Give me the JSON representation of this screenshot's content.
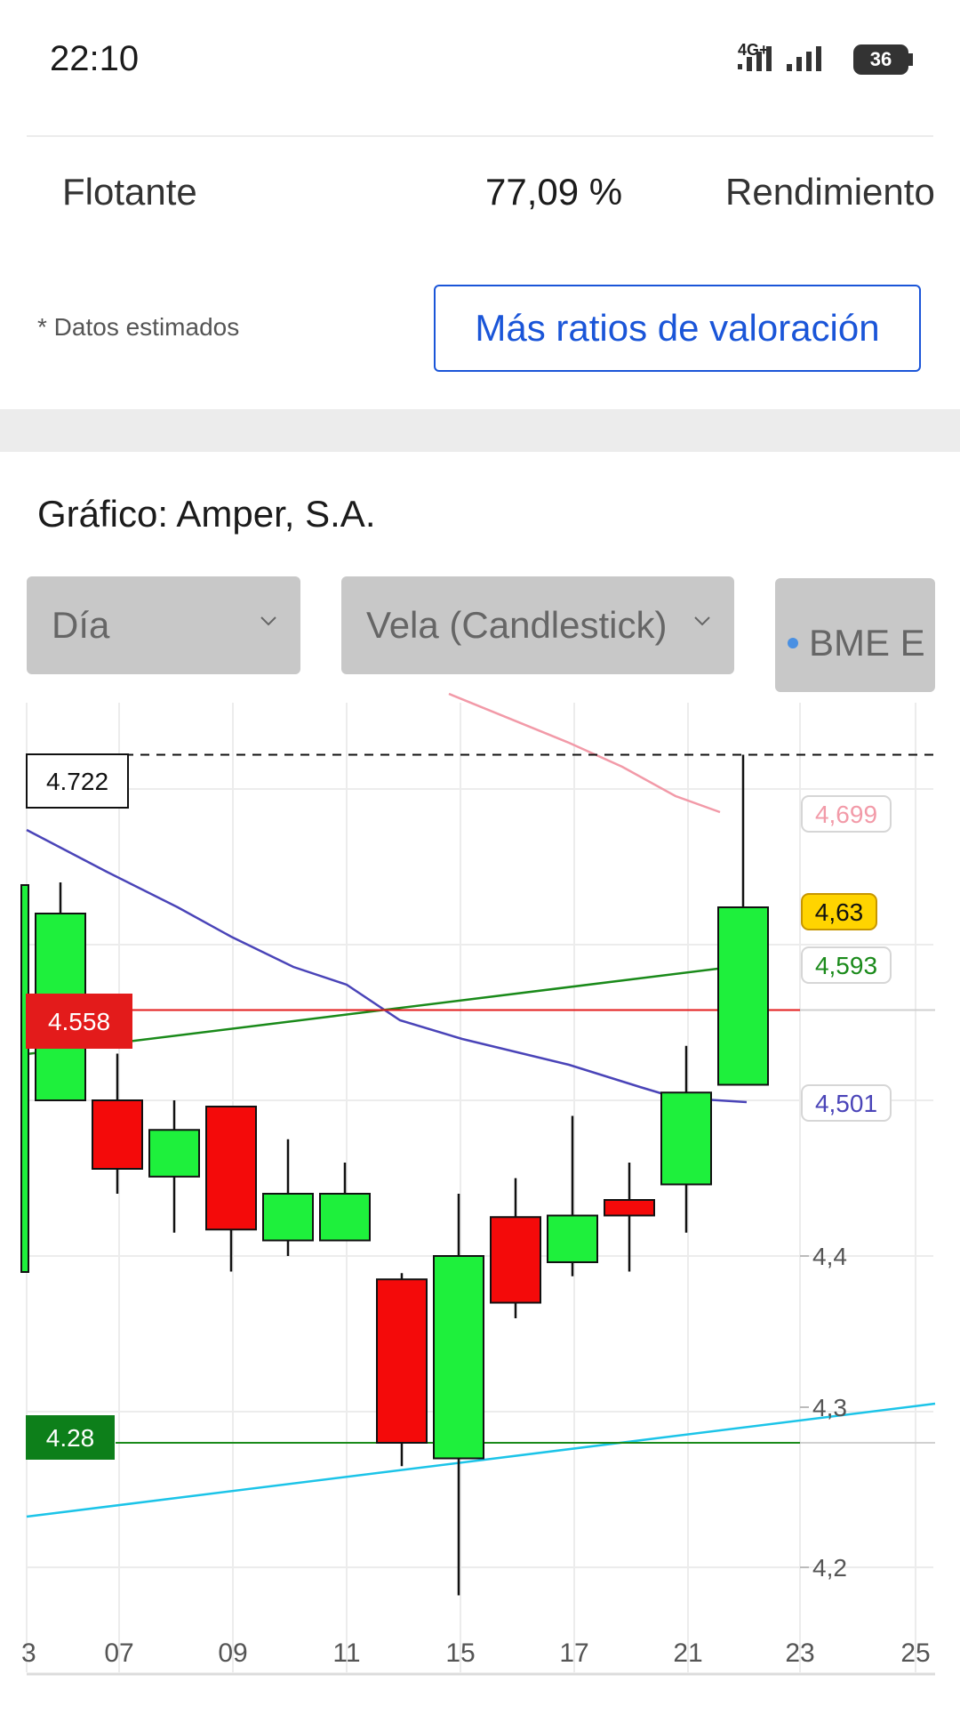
{
  "status_bar": {
    "time": "22:10",
    "network": "4G+",
    "battery": "36"
  },
  "stats_row": {
    "label": "Flotante",
    "value": "77,09 %",
    "next_label": "Rendimiento"
  },
  "note": "* Datos estimados",
  "ratios_button": "Más ratios de valoración",
  "chart_section": {
    "title": "Gráfico: Amper, S.A.",
    "period_select": "Día",
    "type_select": "Vela (Candlestick)",
    "market_select": "BME E"
  },
  "colors": {
    "up": "#1ef03c",
    "down": "#f40a0a",
    "accent": "#1a55d8"
  },
  "chart_data": {
    "type": "candlestick",
    "x_tick_labels": [
      "3",
      "07",
      "09",
      "11",
      "15",
      "17",
      "21",
      "23",
      "25"
    ],
    "y_tick_labels": [
      "4,4",
      "4,3",
      "4,2"
    ],
    "candles": [
      {
        "open": 4.5,
        "close": 4.62,
        "high": 4.64,
        "low": 4.5
      },
      {
        "open": 4.5,
        "close": 4.456,
        "high": 4.53,
        "low": 4.44
      },
      {
        "open": 4.451,
        "close": 4.481,
        "high": 4.5,
        "low": 4.415
      },
      {
        "open": 4.496,
        "close": 4.417,
        "high": 4.496,
        "low": 4.39
      },
      {
        "open": 4.41,
        "close": 4.44,
        "high": 4.475,
        "low": 4.4
      },
      {
        "open": 4.41,
        "close": 4.44,
        "high": 4.46,
        "low": 4.41
      },
      {
        "open": 4.385,
        "close": 4.28,
        "high": 4.389,
        "low": 4.265
      },
      {
        "open": 4.27,
        "close": 4.4,
        "high": 4.44,
        "low": 4.182
      },
      {
        "open": 4.425,
        "close": 4.37,
        "high": 4.45,
        "low": 4.36
      },
      {
        "open": 4.396,
        "close": 4.426,
        "high": 4.49,
        "low": 4.387
      },
      {
        "open": 4.436,
        "close": 4.426,
        "high": 4.46,
        "low": 4.39
      },
      {
        "open": 4.446,
        "close": 4.505,
        "high": 4.535,
        "low": 4.415
      },
      {
        "open": 4.51,
        "close": 4.624,
        "high": 4.722,
        "low": 4.51
      }
    ],
    "price_labels": {
      "high_marker": "4.722",
      "ma_pink": "4,699",
      "last": "4,63",
      "ma_green": "4,593",
      "resistance": "4.558",
      "ma_blue": "4,501",
      "support": "4.28"
    },
    "levels": {
      "high": 4.722,
      "resistance": 4.558,
      "support": 4.28
    },
    "ylim": [
      4.17,
      4.78
    ]
  }
}
